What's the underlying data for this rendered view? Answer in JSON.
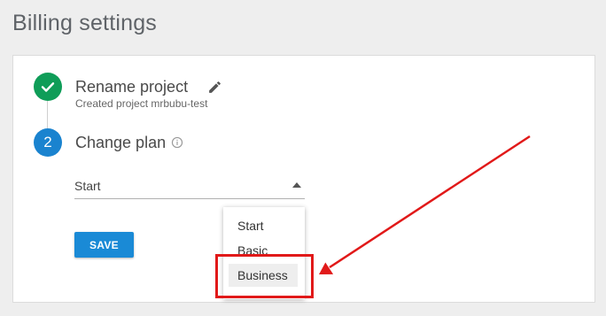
{
  "page": {
    "title": "Billing settings"
  },
  "steps": [
    {
      "title": "Rename project",
      "subtitle": "Created project mrbubu-test",
      "status": "done"
    },
    {
      "number": "2",
      "title": "Change plan"
    }
  ],
  "plan_select": {
    "value": "Start",
    "options": [
      "Start",
      "Basic",
      "Business"
    ],
    "highlighted": "Business"
  },
  "save_button": {
    "label": "SAVE"
  },
  "colors": {
    "done": "#0f9d58",
    "active": "#1a83cf",
    "annotation": "#e11919"
  },
  "icons": {
    "done": "checkmark-icon",
    "edit": "pencil-icon",
    "info": "info-icon",
    "select": "triangle-up-icon"
  }
}
